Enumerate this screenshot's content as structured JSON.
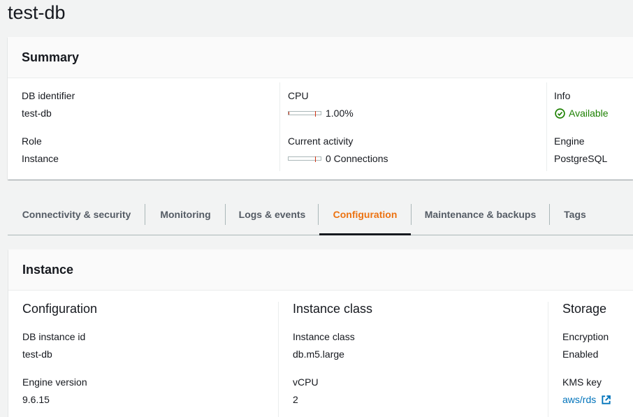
{
  "page": {
    "title": "test-db"
  },
  "summary": {
    "heading": "Summary",
    "db_identifier_label": "DB identifier",
    "db_identifier_value": "test-db",
    "role_label": "Role",
    "role_value": "Instance",
    "cpu_label": "CPU",
    "cpu_value": "1.00%",
    "cpu_fraction": 0.01,
    "activity_label": "Current activity",
    "activity_value": "0 Connections",
    "activity_fraction": 0,
    "info_label": "Info",
    "info_value": "Available",
    "engine_label": "Engine",
    "engine_value": "PostgreSQL"
  },
  "tabs": [
    {
      "label": "Connectivity & security"
    },
    {
      "label": "Monitoring"
    },
    {
      "label": "Logs & events"
    },
    {
      "label": "Configuration",
      "active": true
    },
    {
      "label": "Maintenance & backups"
    },
    {
      "label": "Tags"
    }
  ],
  "instance": {
    "heading": "Instance",
    "configuration": {
      "title": "Configuration",
      "instance_id_label": "DB instance id",
      "instance_id_value": "test-db",
      "engine_version_label": "Engine version",
      "engine_version_value": "9.6.15"
    },
    "instance_class": {
      "title": "Instance class",
      "class_label": "Instance class",
      "class_value": "db.m5.large",
      "vcpu_label": "vCPU",
      "vcpu_value": "2"
    },
    "storage": {
      "title": "Storage",
      "encryption_label": "Encryption",
      "encryption_value": "Enabled",
      "kms_label": "KMS key",
      "kms_value": "aws/rds"
    }
  },
  "colors": {
    "accent_tab": "#ec7211",
    "status_ok": "#1d8102",
    "link": "#0073bb",
    "bar_fill": "#d13212"
  },
  "icons": {
    "status": "check-circle-icon",
    "external": "external-link-icon"
  }
}
